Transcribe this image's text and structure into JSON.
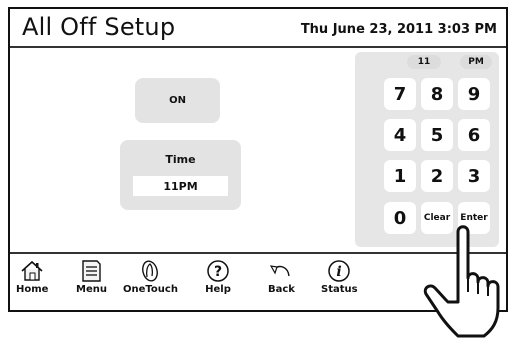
{
  "header": {
    "title": "All Off Setup",
    "datetime": "Thu June 23, 2011  3:03 PM"
  },
  "main": {
    "on_button": "ON",
    "time_label": "Time",
    "time_value": "11PM"
  },
  "keypad": {
    "display_hour": "11",
    "display_ampm": "PM",
    "keys": [
      "7",
      "8",
      "9",
      "4",
      "5",
      "6",
      "1",
      "2",
      "3",
      "0",
      "Clear",
      "Enter"
    ]
  },
  "nav": {
    "items": [
      {
        "label": "Home",
        "icon": "house-icon"
      },
      {
        "label": "Menu",
        "icon": "menu-icon"
      },
      {
        "label": "OneTouch",
        "icon": "touch-icon"
      },
      {
        "label": "Help",
        "icon": "help-icon"
      },
      {
        "label": "Back",
        "icon": "back-arrow-icon"
      },
      {
        "label": "Status",
        "icon": "info-icon"
      }
    ]
  },
  "colors": {
    "panel_gray": "#e3e3e3",
    "border": "#111111"
  }
}
